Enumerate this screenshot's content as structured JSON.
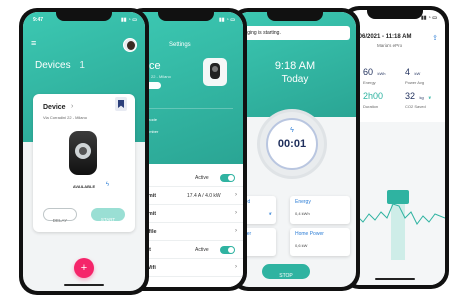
{
  "phone1": {
    "time": "9:47",
    "header_title": "Devices",
    "device_count": "1",
    "card": {
      "title": "Device",
      "address": "Via Corradini 22 - Milano",
      "status": "AVAILABLE",
      "delay_label": "DELAY",
      "start_label": "START"
    },
    "fab_label": "+"
  },
  "phone2": {
    "header_title": "Settings",
    "device_title_fragment": "ce",
    "device_address_fragment": "22 - Milano",
    "info_rows": [
      {
        "label": "",
        "value": ""
      },
      {
        "label": "mode",
        "value": ""
      },
      {
        "label": "umber",
        "value": ""
      },
      {
        "label": "",
        "value": ""
      },
      {
        "label": "e",
        "value": ""
      }
    ],
    "active_label": "Active",
    "limit_label": "Limit",
    "limit_value": "17.4 A / 4.0 kW",
    "limit2_label": "Limit",
    "profile_label": "er profile",
    "start_label": "start",
    "start_active": "Active",
    "wifi_label": "nect Wifi"
  },
  "phone3": {
    "banner": "harging is starting.",
    "time": "9:18 AM",
    "day": "Today",
    "timer": "00:01",
    "tiles": [
      {
        "label": "saved",
        "value": ""
      },
      {
        "label": "Energy",
        "value": "0,4 kWh"
      },
      {
        "label": "Power",
        "value": ""
      },
      {
        "label": "Home Power",
        "value": "0,6 kW"
      }
    ],
    "stop_label": "STOP"
  },
  "phone4": {
    "date": "/06/2021 - 11:18 AM",
    "subtitle": "Maria's ePro",
    "stats": [
      {
        "value": "60",
        "unit": "kWh",
        "label": "Energy"
      },
      {
        "value": "4",
        "unit": "kW",
        "label": "Power Avg"
      },
      {
        "value": "2h00",
        "unit": "",
        "label": "Duration"
      },
      {
        "value": "32",
        "unit": "kg",
        "label": "CO2 Saved"
      }
    ]
  },
  "colors": {
    "teal": "#2fb3a1",
    "pink": "#f5256a",
    "navy": "#1f2f5c",
    "blue_accent": "#2f7fd6"
  }
}
